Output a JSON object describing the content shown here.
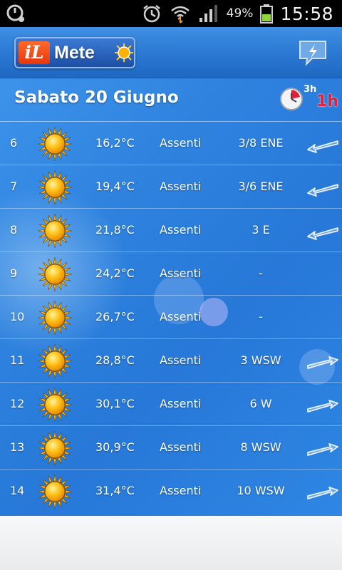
{
  "status_bar": {
    "battery_percent": "49%",
    "time": "15:58",
    "icons": [
      "sync-icon",
      "alarm-icon",
      "wifi-icon",
      "signal-icon",
      "battery-icon"
    ]
  },
  "app": {
    "logo_il": "iL",
    "logo_text": "Mete"
  },
  "day": {
    "title": "Sabato 20 Giugno",
    "interval_3h": "3h",
    "interval_1h": "1h"
  },
  "forecast": [
    {
      "hour": "6",
      "icon": "sun-icon",
      "temp": "16,2°C",
      "rain": "Assenti",
      "wind": "3/8 ENE",
      "arrow": "left"
    },
    {
      "hour": "7",
      "icon": "sun-icon",
      "temp": "19,4°C",
      "rain": "Assenti",
      "wind": "3/6 ENE",
      "arrow": "left"
    },
    {
      "hour": "8",
      "icon": "sun-icon",
      "temp": "21,8°C",
      "rain": "Assenti",
      "wind": "3 E",
      "arrow": "left"
    },
    {
      "hour": "9",
      "icon": "sun-icon",
      "temp": "24,2°C",
      "rain": "Assenti",
      "wind": "-",
      "arrow": "none"
    },
    {
      "hour": "10",
      "icon": "sun-icon",
      "temp": "26,7°C",
      "rain": "Assenti",
      "wind": "-",
      "arrow": "none"
    },
    {
      "hour": "11",
      "icon": "sun-icon",
      "temp": "28,8°C",
      "rain": "Assenti",
      "wind": "3 WSW",
      "arrow": "right"
    },
    {
      "hour": "12",
      "icon": "sun-icon",
      "temp": "30,1°C",
      "rain": "Assenti",
      "wind": "6 W",
      "arrow": "right"
    },
    {
      "hour": "13",
      "icon": "sun-icon",
      "temp": "30,9°C",
      "rain": "Assenti",
      "wind": "8 WSW",
      "arrow": "right"
    },
    {
      "hour": "14",
      "icon": "sun-icon",
      "temp": "31,4°C",
      "rain": "Assenti",
      "wind": "10 WSW",
      "arrow": "right"
    }
  ],
  "colors": {
    "accent_blue": "#2a78d2",
    "interval_active": "#e0203c",
    "sun_yellow": "#ffc21a"
  }
}
